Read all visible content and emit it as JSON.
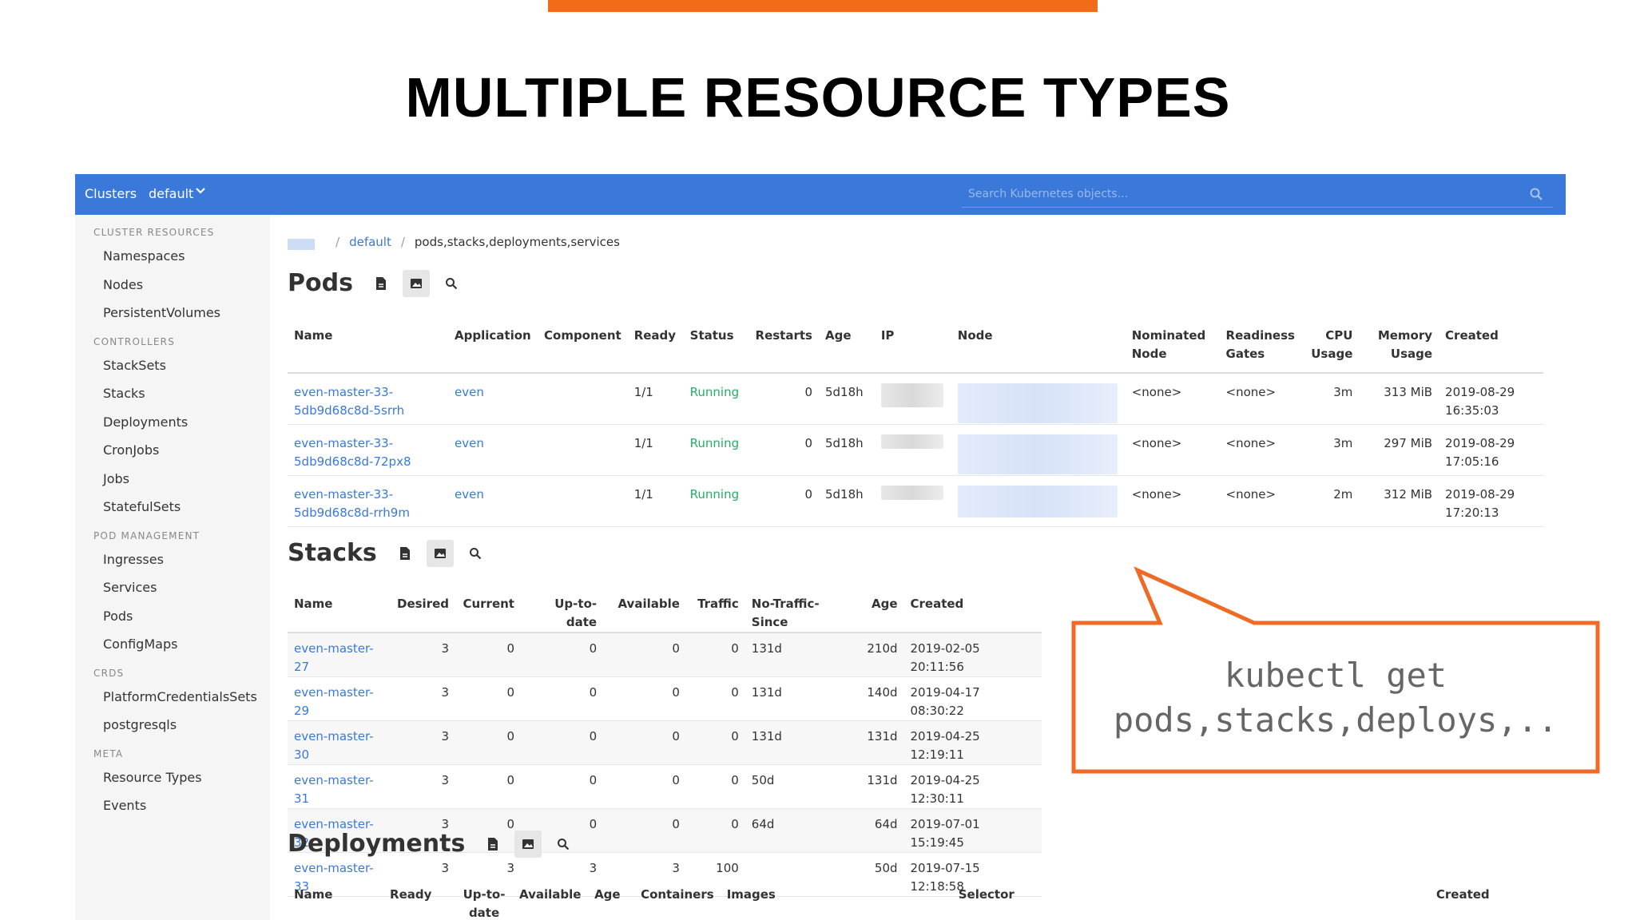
{
  "slide": {
    "title": "MULTIPLE RESOURCE TYPES"
  },
  "navbar": {
    "clusters_label": "Clusters",
    "namespace": "default",
    "search_placeholder": "Search Kubernetes objects..."
  },
  "sidebar": {
    "sections": [
      {
        "title": "CLUSTER RESOURCES",
        "items": [
          "Namespaces",
          "Nodes",
          "PersistentVolumes"
        ]
      },
      {
        "title": "CONTROLLERS",
        "items": [
          "StackSets",
          "Stacks",
          "Deployments",
          "CronJobs",
          "Jobs",
          "StatefulSets"
        ]
      },
      {
        "title": "POD MANAGEMENT",
        "items": [
          "Ingresses",
          "Services",
          "Pods",
          "ConfigMaps"
        ]
      },
      {
        "title": "CRDS",
        "items": [
          "PlatformCredentialsSets",
          "postgresqls"
        ]
      },
      {
        "title": "META",
        "items": [
          "Resource Types",
          "Events"
        ]
      }
    ]
  },
  "breadcrumb": {
    "namespace": "default",
    "resource": "pods,stacks,deployments,services"
  },
  "pods": {
    "title": "Pods",
    "headers": [
      "Name",
      "Application",
      "Component",
      "Ready",
      "Status",
      "Restarts",
      "Age",
      "IP",
      "Node",
      "Nominated Node",
      "Readiness Gates",
      "CPU Usage",
      "Memory Usage",
      "Created"
    ],
    "rows": [
      {
        "name": "even-master-33-5db9d68c8d-5srrh",
        "application": "even",
        "component": "",
        "ready": "1/1",
        "status": "Running",
        "restarts": "0",
        "age": "5d18h",
        "nominated": "<none>",
        "gates": "<none>",
        "cpu": "3m",
        "memory": "313 MiB",
        "created": "2019-08-29 16:35:03"
      },
      {
        "name": "even-master-33-5db9d68c8d-72px8",
        "application": "even",
        "component": "",
        "ready": "1/1",
        "status": "Running",
        "restarts": "0",
        "age": "5d18h",
        "nominated": "<none>",
        "gates": "<none>",
        "cpu": "3m",
        "memory": "297 MiB",
        "created": "2019-08-29 17:05:16"
      },
      {
        "name": "even-master-33-5db9d68c8d-rrh9m",
        "application": "even",
        "component": "",
        "ready": "1/1",
        "status": "Running",
        "restarts": "0",
        "age": "5d18h",
        "nominated": "<none>",
        "gates": "<none>",
        "cpu": "2m",
        "memory": "312 MiB",
        "created": "2019-08-29 17:20:13"
      }
    ]
  },
  "stacks": {
    "title": "Stacks",
    "headers": [
      "Name",
      "Desired",
      "Current",
      "Up-to-date",
      "Available",
      "Traffic",
      "No-Traffic-Since",
      "Age",
      "Created"
    ],
    "rows": [
      [
        "even-master-27",
        "3",
        "0",
        "0",
        "0",
        "0",
        "131d",
        "210d",
        "2019-02-05 20:11:56"
      ],
      [
        "even-master-29",
        "3",
        "0",
        "0",
        "0",
        "0",
        "131d",
        "140d",
        "2019-04-17 08:30:22"
      ],
      [
        "even-master-30",
        "3",
        "0",
        "0",
        "0",
        "0",
        "131d",
        "131d",
        "2019-04-25 12:19:11"
      ],
      [
        "even-master-31",
        "3",
        "0",
        "0",
        "0",
        "0",
        "50d",
        "131d",
        "2019-04-25 12:30:11"
      ],
      [
        "even-master-32",
        "3",
        "0",
        "0",
        "0",
        "0",
        "64d",
        "64d",
        "2019-07-01 15:19:45"
      ],
      [
        "even-master-33",
        "3",
        "3",
        "3",
        "3",
        "100",
        "",
        "50d",
        "2019-07-15 12:18:58"
      ]
    ]
  },
  "deployments": {
    "title": "Deployments",
    "headers": [
      "Name",
      "Ready",
      "Up-to-date",
      "Available",
      "Age",
      "Containers",
      "Images",
      "Selector",
      "Created"
    ]
  },
  "callout": {
    "line1": "kubectl get",
    "line2": "pods,stacks,deploys,.."
  },
  "colors": {
    "accent_orange": "#f26b16",
    "navbar_blue": "#3a79d9",
    "link_blue": "#3a79d9",
    "status_green": "#27ae60"
  }
}
